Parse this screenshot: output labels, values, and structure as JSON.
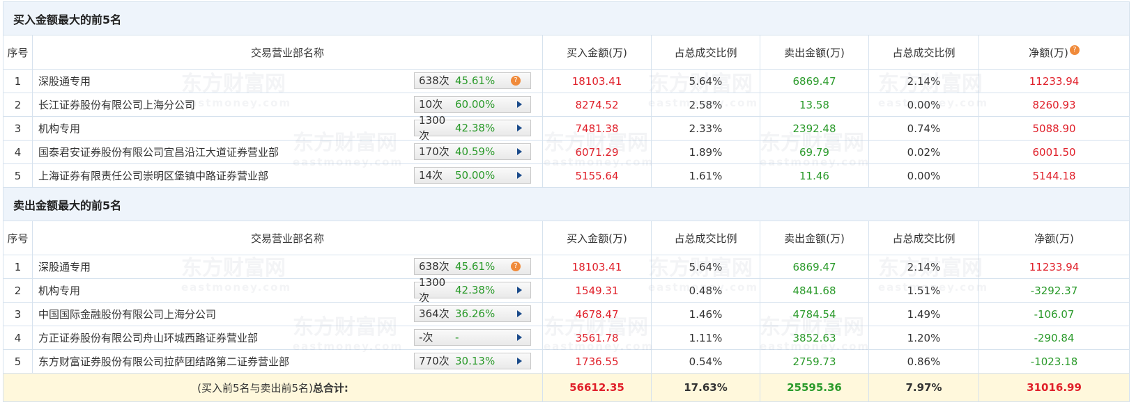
{
  "buy_section": {
    "title": "买入金额最大的前5名",
    "headers": {
      "idx": "序号",
      "name": "交易营业部名称",
      "buy": "买入金额(万)",
      "buy_ratio": "占总成交比例",
      "sell": "卖出金额(万)",
      "sell_ratio": "占总成交比例",
      "net": "净额(万)"
    },
    "rows": [
      {
        "idx": "1",
        "name": "深股通专用",
        "count": "638次",
        "pct": "45.61%",
        "buy": "18103.41",
        "buy_ratio": "5.64%",
        "sell": "6869.47",
        "sell_ratio": "2.14%",
        "net": "11233.94"
      },
      {
        "idx": "2",
        "name": "长江证券股份有限公司上海分公司",
        "count": "10次",
        "pct": "60.00%",
        "buy": "8274.52",
        "buy_ratio": "2.58%",
        "sell": "13.58",
        "sell_ratio": "0.00%",
        "net": "8260.93"
      },
      {
        "idx": "3",
        "name": "机构专用",
        "count": "1300次",
        "pct": "42.38%",
        "buy": "7481.38",
        "buy_ratio": "2.33%",
        "sell": "2392.48",
        "sell_ratio": "0.74%",
        "net": "5088.90"
      },
      {
        "idx": "4",
        "name": "国泰君安证券股份有限公司宜昌沿江大道证券营业部",
        "count": "170次",
        "pct": "40.59%",
        "buy": "6071.29",
        "buy_ratio": "1.89%",
        "sell": "69.79",
        "sell_ratio": "0.02%",
        "net": "6001.50"
      },
      {
        "idx": "5",
        "name": "上海证券有限责任公司崇明区堡镇中路证券营业部",
        "count": "14次",
        "pct": "50.00%",
        "buy": "5155.64",
        "buy_ratio": "1.61%",
        "sell": "11.46",
        "sell_ratio": "0.00%",
        "net": "5144.18"
      }
    ]
  },
  "sell_section": {
    "title": "卖出金额最大的前5名",
    "headers": {
      "idx": "序号",
      "name": "交易营业部名称",
      "buy": "买入金额(万)",
      "buy_ratio": "占总成交比例",
      "sell": "卖出金额(万)",
      "sell_ratio": "占总成交比例",
      "net": "净额(万)"
    },
    "rows": [
      {
        "idx": "1",
        "name": "深股通专用",
        "count": "638次",
        "pct": "45.61%",
        "buy": "18103.41",
        "buy_ratio": "5.64%",
        "sell": "6869.47",
        "sell_ratio": "2.14%",
        "net": "11233.94"
      },
      {
        "idx": "2",
        "name": "机构专用",
        "count": "1300次",
        "pct": "42.38%",
        "buy": "1549.31",
        "buy_ratio": "0.48%",
        "sell": "4841.68",
        "sell_ratio": "1.51%",
        "net": "-3292.37"
      },
      {
        "idx": "3",
        "name": "中国国际金融股份有限公司上海分公司",
        "count": "364次",
        "pct": "36.26%",
        "buy": "4678.47",
        "buy_ratio": "1.46%",
        "sell": "4784.54",
        "sell_ratio": "1.49%",
        "net": "-106.07"
      },
      {
        "idx": "4",
        "name": "方正证券股份有限公司舟山环城西路证券营业部",
        "count": "-次",
        "pct": "-",
        "buy": "3561.78",
        "buy_ratio": "1.11%",
        "sell": "3852.63",
        "sell_ratio": "1.20%",
        "net": "-290.84"
      },
      {
        "idx": "5",
        "name": "东方财富证券股份有限公司拉萨团结路第二证券营业部",
        "count": "770次",
        "pct": "30.13%",
        "buy": "1736.55",
        "buy_ratio": "0.54%",
        "sell": "2759.73",
        "sell_ratio": "0.86%",
        "net": "-1023.18"
      }
    ]
  },
  "total": {
    "label_prefix": "(买入前5名与卖出前5名)",
    "label_bold": "总合计:",
    "buy": "56612.35",
    "buy_ratio": "17.63%",
    "sell": "25595.36",
    "sell_ratio": "7.97%",
    "net": "31016.99"
  },
  "watermark": {
    "cn": "东方财富网",
    "en": "eastmoney.com"
  },
  "help_glyph": "?",
  "colors": {
    "header_bg": "#eef4fb",
    "border": "#d6e2ee",
    "red": "#e0202a",
    "green": "#2a9a2a",
    "total_bg": "#fff8dc",
    "help": "#f08a3a"
  }
}
